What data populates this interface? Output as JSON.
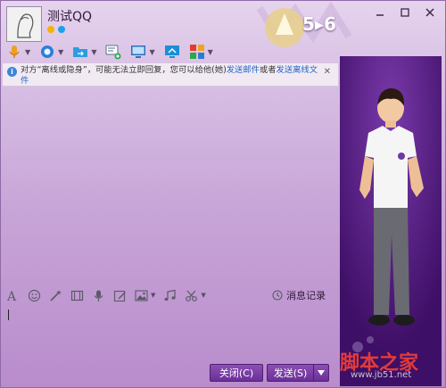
{
  "window": {
    "title": "测试QQ",
    "badge": "5▸6"
  },
  "notice": {
    "text_prefix": "对方“离线或隐身”，可能无法立即回复，您可以给他(她)",
    "link_email": "发送邮件",
    "text_middle": "或者",
    "link_offline_file": "发送离线文件"
  },
  "input": {
    "history_label": "消息记录"
  },
  "buttons": {
    "close_label": "关闭(C)",
    "send_label": "发送(S)"
  },
  "watermark": {
    "text": "脚本之家",
    "sub": "www.jb51.net"
  },
  "colors": {
    "window_bg": "#c7a4d7",
    "side_panel": "#4a1577",
    "button": "#6b2f98",
    "link": "#1f63c9"
  }
}
